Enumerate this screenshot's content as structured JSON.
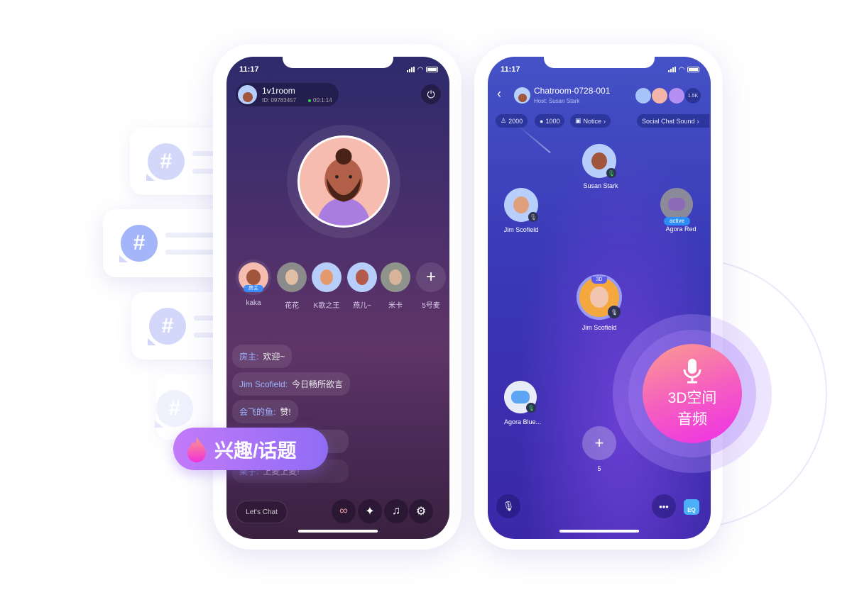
{
  "decor": {
    "tag_label": "兴趣/话题",
    "badge_line1": "3D空间",
    "badge_line2": "音频",
    "hash_symbol": "#"
  },
  "left_phone": {
    "status": {
      "time": "11:17"
    },
    "room": {
      "name": "1v1room",
      "id": "ID: 09783457",
      "duration": "00:1:14"
    },
    "seats": [
      {
        "name": "kaka",
        "badge": "房主",
        "color": "#f9b9a6"
      },
      {
        "name": "花花",
        "color": "#9a9a9a"
      },
      {
        "name": "K歌之王",
        "color": "#b7cdfa"
      },
      {
        "name": "燕儿~",
        "color": "#b7cdfa"
      },
      {
        "name": "米卡",
        "color": "#8e948c"
      },
      {
        "name": "5号麦",
        "add": "+"
      }
    ],
    "chat": [
      {
        "user": "房主:",
        "text": "欢迎~"
      },
      {
        "user": "Jim Scofield:",
        "text": "今日畅所欲言"
      },
      {
        "user": "会飞的鱼:",
        "text": "赞!"
      },
      {
        "user": "",
        "text": ""
      },
      {
        "user": "栗子:",
        "text": "上麦上麦!"
      }
    ],
    "input_placeholder": "Let's Chat",
    "toolbar": [
      "link-icon",
      "magic-wand-icon",
      "music-disc-icon",
      "gear-icon"
    ]
  },
  "right_phone": {
    "status": {
      "time": "11:17"
    },
    "room": {
      "title": "Chatroom-0728-001",
      "host": "Host: Susan Stark",
      "audience_count": "1.5K"
    },
    "chips": {
      "rank": "2000",
      "gifts": "1000",
      "notice": "Notice",
      "sound": "Social Chat Sound"
    },
    "seats": {
      "host": {
        "name": "Susan Stark",
        "mic": "on"
      },
      "jim_top": {
        "name": "Jim Scofield",
        "mic": "muted"
      },
      "agora_red": {
        "name": "Agora Red",
        "status": "active"
      },
      "jim_3d": {
        "name": "Jim Scofield",
        "badge": "3D"
      },
      "agora_blue": {
        "name": "Agora Blue...",
        "mic": "on"
      },
      "empty": {
        "name": "5",
        "add": "+"
      }
    },
    "eq_label": "EQ"
  },
  "colors": {
    "left_bg_top": "#2f2a6e",
    "left_bg_bottom": "#3b2142",
    "right_bg": "#3b3ab8",
    "accent_pink": "#f34fd8",
    "tag_purple": "#a16dfa"
  }
}
